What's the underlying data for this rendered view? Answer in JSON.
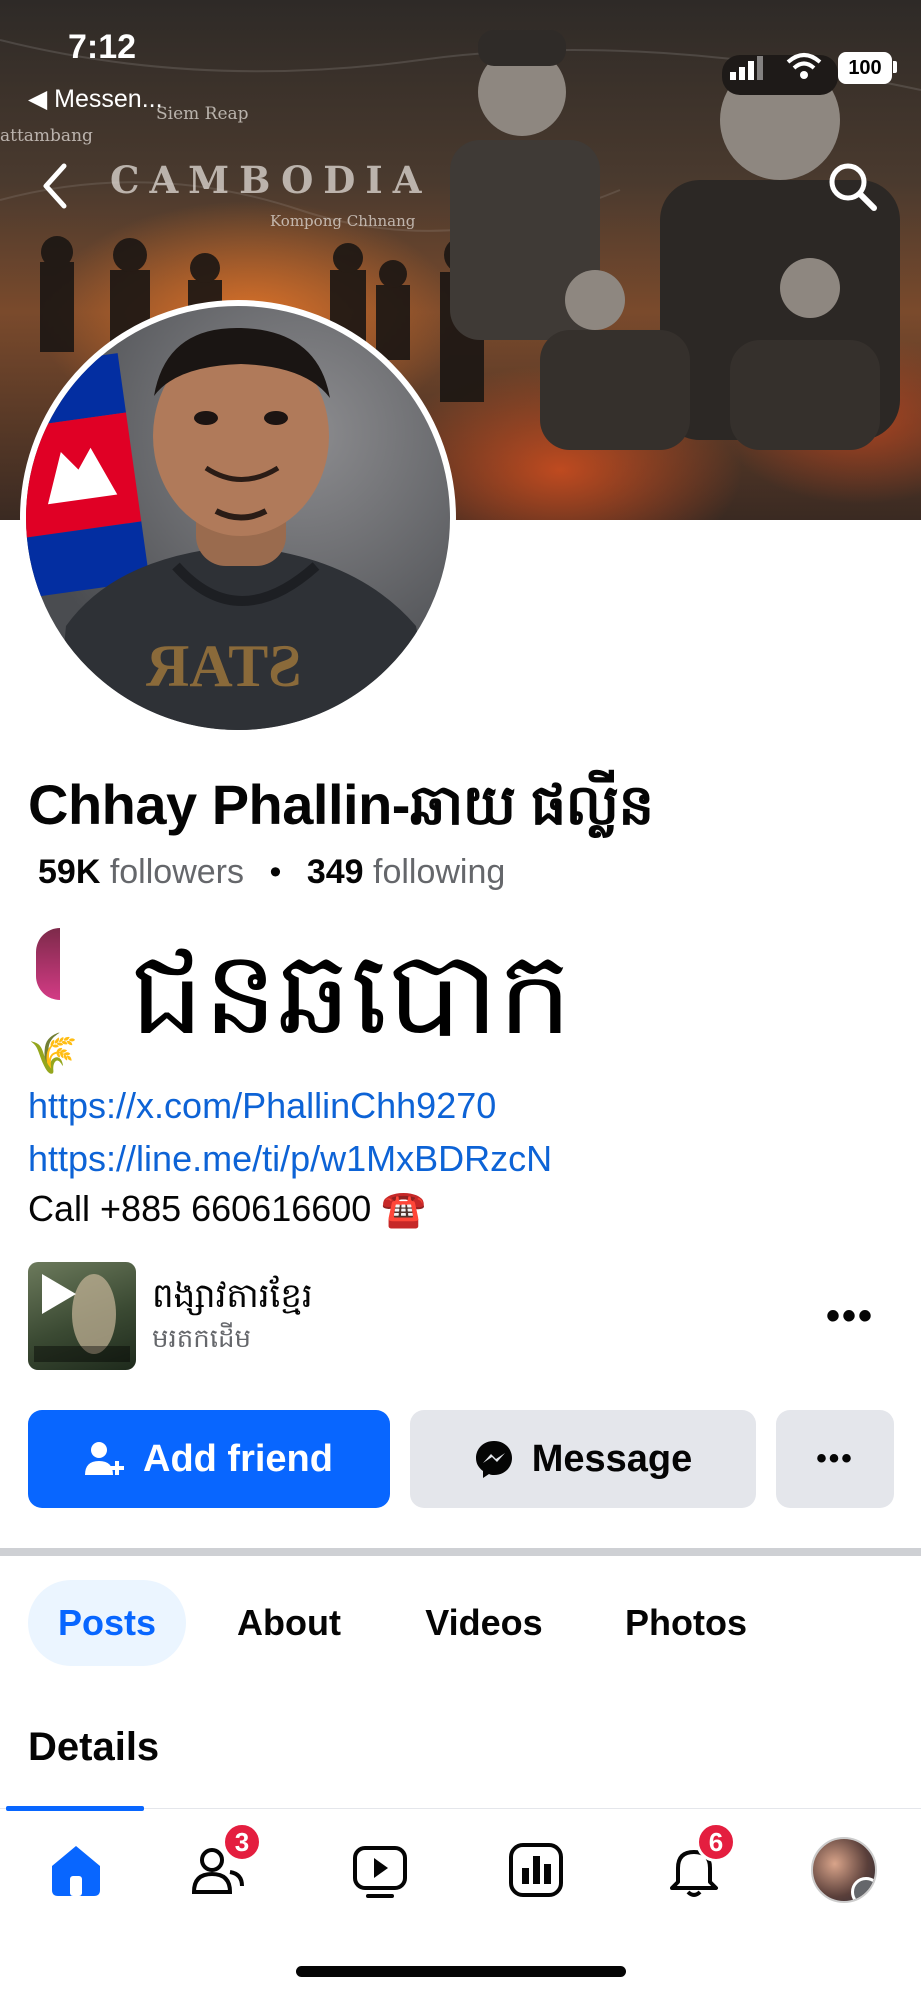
{
  "status_bar": {
    "time": "7:12",
    "back_app": "◀ Messen...",
    "battery": "100"
  },
  "cover": {
    "map_label_city": "Siem Reap",
    "map_label_left": "attambang",
    "map_label_country": "CAMBODIA",
    "map_label_small": "Kompong Chhnang"
  },
  "profile": {
    "name": "Chhay Phallin-ឆាយ ផល្លីន",
    "followers_count": "59K",
    "followers_label": "followers",
    "separator": "•",
    "following_count": "349",
    "following_label": "following"
  },
  "overlay_text": "ជនឆបោក",
  "bio": {
    "sprout": "🌾",
    "link_x": "https://x.com/PhallinChh9270",
    "link_line": "https://line.me/ti/p/w1MxBDRzcN",
    "call": "Call +885 660616600 ☎️"
  },
  "featured_page": {
    "name": "ពង្សាវតារខ្មែរ",
    "subtitle": "មរតកដើម",
    "more": "•••"
  },
  "actions": {
    "add_friend": "Add friend",
    "message": "Message",
    "more": "•••"
  },
  "tabs": [
    "Posts",
    "About",
    "Videos",
    "Photos"
  ],
  "details_heading": "Details",
  "bottom_nav": {
    "friends_badge": "3",
    "notifications_badge": "6"
  },
  "colors": {
    "accent": "#0866ff",
    "badge": "#e41e3f",
    "link": "#0d63d6"
  }
}
